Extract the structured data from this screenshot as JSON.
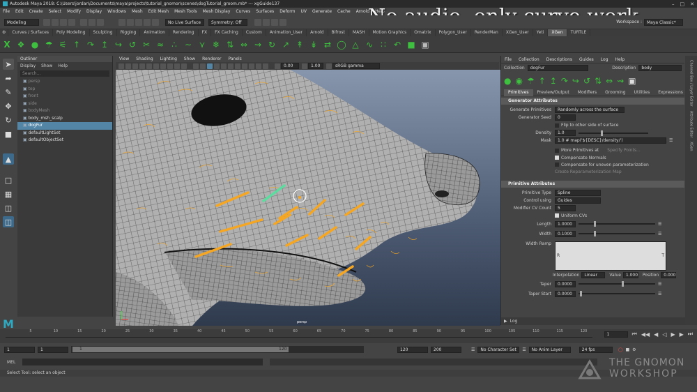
{
  "window": {
    "title": "Autodesk Maya 2018: C:\\Users\\jordan\\Documents\\maya\\projects\\tutorial_gnomon\\scenes\\dogTutorial_groom.mb* --- xgGuide137",
    "workspace_label": "Workspace :",
    "workspace_value": "Maya Classic*"
  },
  "overlay_text": "No audio, only curve work",
  "menubar": [
    "File",
    "Edit",
    "Create",
    "Select",
    "Modify",
    "Display",
    "Windows",
    "Mesh",
    "Edit Mesh",
    "Mesh Tools",
    "Mesh Display",
    "Curves",
    "Surfaces",
    "Deform",
    "UV",
    "Generate",
    "Cache",
    "Arnold",
    "Help"
  ],
  "statusline": {
    "mode": "Modeling",
    "live_surface": "No Live Surface",
    "symmetry": "Symmetry: Off"
  },
  "shelf_tabs": [
    {
      "label": "Curves / Surfaces",
      "active": false
    },
    {
      "label": "Poly Modeling",
      "active": false
    },
    {
      "label": "Sculpting",
      "active": false
    },
    {
      "label": "Rigging",
      "active": false
    },
    {
      "label": "Animation",
      "active": false
    },
    {
      "label": "Rendering",
      "active": false
    },
    {
      "label": "FX",
      "active": false
    },
    {
      "label": "FX Caching",
      "active": false
    },
    {
      "label": "Custom",
      "active": false
    },
    {
      "label": "Animation_User",
      "active": false
    },
    {
      "label": "Arnold",
      "active": false
    },
    {
      "label": "Bifrost",
      "active": false
    },
    {
      "label": "MASH",
      "active": false
    },
    {
      "label": "Motion Graphics",
      "active": false
    },
    {
      "label": "Omatrix",
      "active": false
    },
    {
      "label": "Polygon_User",
      "active": false
    },
    {
      "label": "RenderMan",
      "active": false
    },
    {
      "label": "XGen_User",
      "active": false
    },
    {
      "label": "Yeti",
      "active": false
    },
    {
      "label": "XGen",
      "active": true
    },
    {
      "label": "TURTLE",
      "active": false
    }
  ],
  "outliner": {
    "title": "Outliner",
    "menu": [
      "Display",
      "Show",
      "Help"
    ],
    "search_placeholder": "Search...",
    "items": [
      {
        "label": "persp",
        "dim": true,
        "selected": false
      },
      {
        "label": "top",
        "dim": true,
        "selected": false
      },
      {
        "label": "front",
        "dim": true,
        "selected": false
      },
      {
        "label": "side",
        "dim": true,
        "selected": false
      },
      {
        "label": "bodyMesh",
        "dim": true,
        "selected": false
      },
      {
        "label": "body_msh_scalp",
        "dim": false,
        "selected": false
      },
      {
        "label": "dogFur",
        "dim": false,
        "selected": true
      },
      {
        "label": "defaultLightSet",
        "dim": false,
        "selected": false
      },
      {
        "label": "defaultObjectSet",
        "dim": false,
        "selected": false
      }
    ]
  },
  "viewport": {
    "menu": [
      "View",
      "Shading",
      "Lighting",
      "Show",
      "Renderer",
      "Panels"
    ],
    "exposure": "0.00",
    "gamma": "1.00",
    "color_space": "sRGB gamma",
    "camera_label": "persp"
  },
  "xgen": {
    "menu": [
      "File",
      "Collection",
      "Descriptions",
      "Guides",
      "Log",
      "Help"
    ],
    "collection_label": "Collection",
    "collection_value": "dogFur",
    "description_label": "Description",
    "description_value": "body",
    "tabs": [
      {
        "label": "Primitives",
        "active": true
      },
      {
        "label": "Preview/Output",
        "active": false
      },
      {
        "label": "Modifiers",
        "active": false
      },
      {
        "label": "Grooming",
        "active": false
      },
      {
        "label": "Utilities",
        "active": false
      },
      {
        "label": "Expressions",
        "active": false
      }
    ],
    "generator": {
      "title": "Generator Attributes",
      "generate_primitives_label": "Generate Primitives",
      "generate_primitives_value": "Randomly across the surface",
      "seed_label": "Generator Seed",
      "seed_value": "0",
      "flip_label": "Flip to other side of surface",
      "density_label": "Density",
      "density_value": "1.0",
      "mask_label": "Mask",
      "mask_value": "1.0 # map('${DESC}/density/')",
      "more_primitives_label": "More Primitives at",
      "specify_points_label": "Specify Points...",
      "compensate_normals_label": "Compensate Normals",
      "compensate_uneven_label": "Compensate for uneven parameterization",
      "create_map_label": "Create Reparameterization Map"
    },
    "primitive": {
      "title": "Primitive Attributes",
      "type_label": "Primitive Type",
      "type_value": "Spline",
      "control_label": "Control using",
      "control_value": "Guides",
      "modifier_cv_label": "Modifier CV Count",
      "modifier_cv_value": "5",
      "uniform_cvs_label": "Uniform CVs",
      "length_label": "Length",
      "length_value": "1.0000",
      "width_label": "Width",
      "width_value": "0.1000",
      "width_ramp_label": "Width Ramp",
      "ramp_left": "R",
      "ramp_right": "T",
      "interpolation_label": "Interpolation",
      "interpolation_value": "Linear",
      "value_label": "Value",
      "value_value": "1.000",
      "position_label": "Position",
      "position_value": "0.000",
      "taper_label": "Taper",
      "taper_value": "0.0000",
      "taper_start_label": "Taper Start",
      "taper_start_value": "0.0000"
    },
    "log_label": "Log"
  },
  "side_strip": [
    "Channel Box / Layer Editor",
    "Attribute Editor",
    "XGen"
  ],
  "timeline": {
    "ticks": [
      "5",
      "10",
      "15",
      "20",
      "25",
      "30",
      "35",
      "40",
      "45",
      "50",
      "55",
      "60",
      "65",
      "70",
      "75",
      "80",
      "85",
      "90",
      "95",
      "100",
      "105",
      "110",
      "115",
      "120"
    ],
    "current_frame": "1"
  },
  "range": {
    "start": "1",
    "current": "1",
    "range_start": "1",
    "range_end": "120",
    "end": "120",
    "max": "200",
    "character_set": "No Character Set",
    "anim_layer": "No Anim Layer",
    "fps": "24 fps"
  },
  "mel": {
    "label": "MEL"
  },
  "help_line": "Select Tool: select an object",
  "gnomon": {
    "line1": "THE GNOMON",
    "line2": "WORKSHOP"
  },
  "colors": {
    "selection_blue": "#5285a6",
    "accent_green": "#3fbf3f",
    "curve_orange": "#f5a623",
    "panel_bg": "#444444"
  }
}
